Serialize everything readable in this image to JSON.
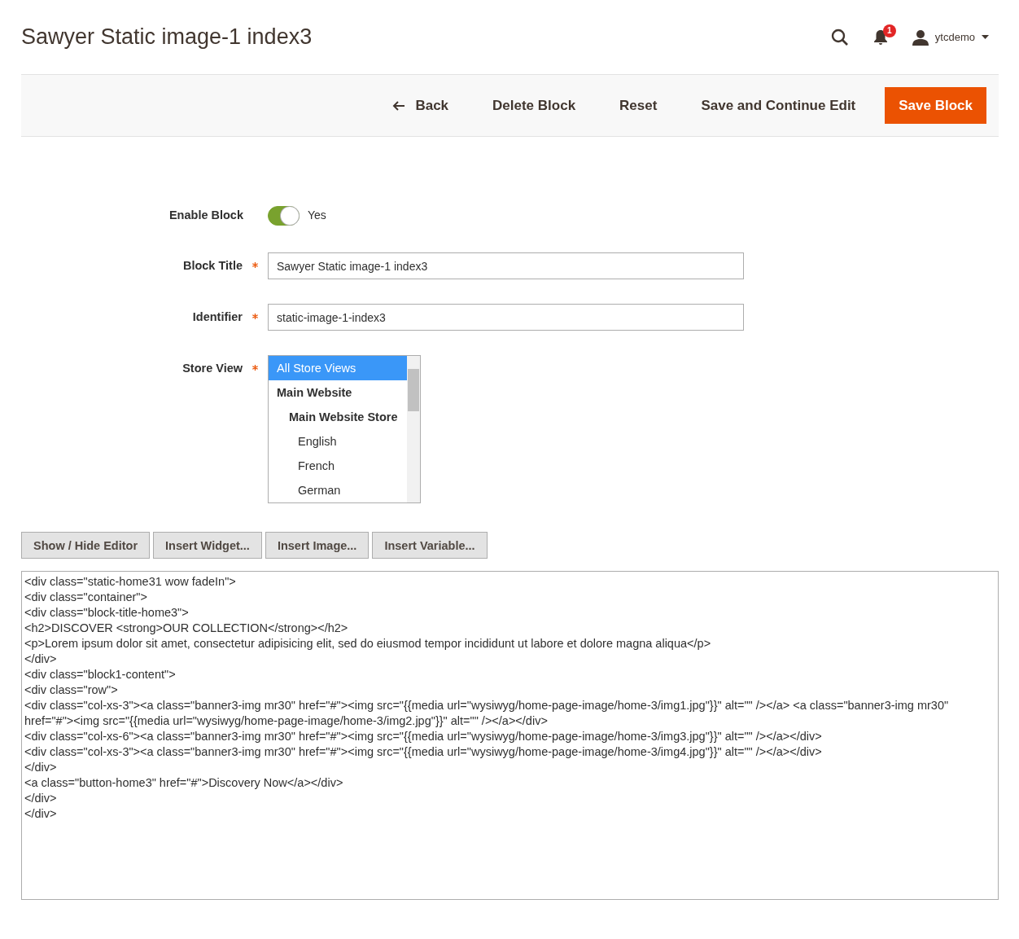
{
  "page_title": "Sawyer Static image-1 index3",
  "header": {
    "notification_count": "1",
    "user": "ytcdemo"
  },
  "actions": [
    {
      "label": "Back",
      "kind": "back"
    },
    {
      "label": "Delete Block",
      "kind": "plain"
    },
    {
      "label": "Reset",
      "kind": "plain"
    },
    {
      "label": "Save and Continue Edit",
      "kind": "plain"
    },
    {
      "label": "Save Block",
      "kind": "primary"
    }
  ],
  "form": {
    "enable_block": {
      "label": "Enable Block",
      "on": true,
      "value": "Yes"
    },
    "block_title": {
      "label": "Block Title",
      "required": true,
      "value": "Sawyer Static image-1 index3"
    },
    "identifier": {
      "label": "Identifier",
      "required": true,
      "value": "static-image-1-index3"
    },
    "store_view": {
      "label": "Store View",
      "required": true,
      "items": [
        {
          "label": "All Store Views",
          "selected": true
        },
        {
          "label": "Main Website",
          "selected": false,
          "children": [
            {
              "label": "Main Website Store",
              "selected": false,
              "children": [
                {
                  "label": "English",
                  "selected": false
                },
                {
                  "label": "French",
                  "selected": false
                },
                {
                  "label": "German",
                  "selected": false
                }
              ]
            }
          ]
        }
      ]
    }
  },
  "editor_buttons": [
    "Show / Hide Editor",
    "Insert Widget...",
    "Insert Image...",
    "Insert Variable..."
  ],
  "content": "<div class=\"static-home31 wow fadeIn\">\n<div class=\"container\">\n<div class=\"block-title-home3\">\n<h2>DISCOVER <strong>OUR COLLECTION</strong></h2>\n<p>Lorem ipsum dolor sit amet, consectetur adipisicing elit, sed do eiusmod tempor incididunt ut labore et dolore magna aliqua</p>\n</div>\n<div class=\"block1-content\">\n<div class=\"row\">\n<div class=\"col-xs-3\"><a class=\"banner3-img mr30\" href=\"#\"><img src=\"{{media url=\"wysiwyg/home-page-image/home-3/img1.jpg\"}}\" alt=\"\" /></a> <a class=\"banner3-img mr30\" href=\"#\"><img src=\"{{media url=\"wysiwyg/home-page-image/home-3/img2.jpg\"}}\" alt=\"\" /></a></div>\n<div class=\"col-xs-6\"><a class=\"banner3-img mr30\" href=\"#\"><img src=\"{{media url=\"wysiwyg/home-page-image/home-3/img3.jpg\"}}\" alt=\"\" /></a></div>\n<div class=\"col-xs-3\"><a class=\"banner3-img mr30\" href=\"#\"><img src=\"{{media url=\"wysiwyg/home-page-image/home-3/img4.jpg\"}}\" alt=\"\" /></a></div>\n</div>\n<a class=\"button-home3\" href=\"#\">Discovery Now</a></div>\n</div>\n</div>"
}
